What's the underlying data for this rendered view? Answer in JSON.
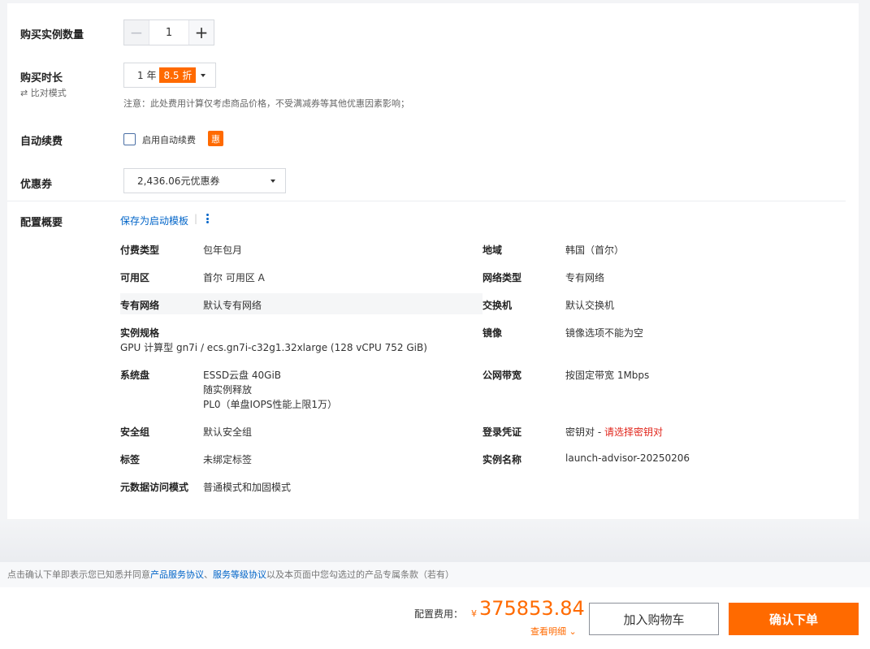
{
  "quantity": {
    "label": "购买实例数量",
    "value": "1",
    "minus": "−",
    "plus": "+"
  },
  "duration": {
    "label": "购买时长",
    "compare_icon": "⇄",
    "compare": "比对模式",
    "value": "1 年",
    "discount": "8.5 折",
    "note": "注意：此处费用计算仅考虑商品价格，不受满减券等其他优惠因素影响；"
  },
  "auto_renew": {
    "label": "自动续费",
    "checkbox_label": "启用自动续费",
    "badge": "惠"
  },
  "coupon": {
    "label": "优惠券",
    "value": "2,436.06元优惠券"
  },
  "summary": {
    "label": "配置概要",
    "save_template": "保存为启动模板",
    "separator": "|",
    "rows": {
      "billing_type": {
        "k": "付费类型",
        "v": "包年包月"
      },
      "region": {
        "k": "地域",
        "v": "韩国（首尔）"
      },
      "zone": {
        "k": "可用区",
        "v": "首尔 可用区 A"
      },
      "network_type": {
        "k": "网络类型",
        "v": "专有网络"
      },
      "vpc": {
        "k": "专有网络",
        "v": "默认专有网络"
      },
      "vswitch": {
        "k": "交换机",
        "v": "默认交换机"
      },
      "spec": {
        "k": "实例规格",
        "v": "GPU 计算型 gn7i / ecs.gn7i-c32g1.32xlarge (128 vCPU 752 GiB)"
      },
      "image": {
        "k": "镜像",
        "v": "镜像选项不能为空"
      },
      "system_disk": {
        "k": "系统盘",
        "v1": "ESSD云盘 40GiB",
        "v2": "随实例释放",
        "v3": "PL0（单盘IOPS性能上限1万）"
      },
      "bandwidth": {
        "k": "公网带宽",
        "v": "按固定带宽 1Mbps"
      },
      "security_group": {
        "k": "安全组",
        "v": "默认安全组"
      },
      "credential": {
        "k": "登录凭证",
        "v": "密钥对 - ",
        "link": "请选择密钥对"
      },
      "tags": {
        "k": "标签",
        "v": "未绑定标签"
      },
      "instance_name": {
        "k": "实例名称",
        "v": "launch-advisor-20250206"
      },
      "metadata": {
        "k": "元数据访问模式",
        "v": "普通模式和加固模式"
      }
    }
  },
  "agreement": {
    "prefix": "点击确认下单即表示您已知悉并同意",
    "link1": "产品服务协议",
    "sep": "、",
    "link2": "服务等级协议",
    "suffix": "以及本页面中您勾选过的产品专属条款（若有）"
  },
  "footer": {
    "fee_label": "配置费用：",
    "currency": "¥",
    "price": "375853.84",
    "detail": "查看明细 ⌄",
    "cart": "加入购物车",
    "confirm": "确认下单"
  },
  "colors": {
    "accent": "#ff6a00",
    "link": "#0064c8",
    "error": "#e1251b"
  }
}
